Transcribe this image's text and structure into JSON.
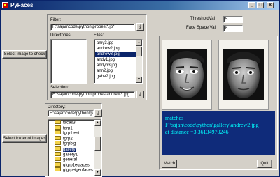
{
  "window": {
    "title": "PyFaces"
  },
  "left_buttons": {
    "select_image": "Select image to check",
    "select_folder": "Select folder of images"
  },
  "probe_panel": {
    "filter_label": "Filter:",
    "filter_value": "F:\\sajan\\code\\python\\probes\\*.jp*",
    "directories_label": "Directories:",
    "files_label": "Files:",
    "files": [
      "amy3.jpg",
      "andrew2.jpg",
      "andrew3.jpg",
      "andy1.jpg",
      "andyb3.jpg",
      "ann2.jpg",
      "gabe2.jpg"
    ],
    "selected_file_index": 2,
    "selection_label": "Selection:",
    "selection_value": "F:\\sajan\\code\\python\\probes\\andrew3.jpg"
  },
  "dir_panel": {
    "directory_label": "Directory:",
    "directory_value": "F:\\sajan\\code\\python\\gallery\\",
    "folders": [
      "faces3",
      "fgrp1",
      "fgrp1test",
      "fgrp2",
      "fgrpbig",
      "gallery",
      "gallery1",
      "general",
      "gfgrp1eglaces",
      "gfgrpeigenfaces"
    ],
    "selected_folder_index": 5
  },
  "params": {
    "threshold_label": "ThresholdVal",
    "threshold_value": "5",
    "facespace_label": "Face Space Val",
    "facespace_value": "6"
  },
  "result": {
    "line1": "matches",
    "line2": "F:\\sajan\\code\\python\\gallery\\andrew2.jpg",
    "line3": "at distance =3.36134970246"
  },
  "buttons": {
    "match": "Match",
    "quit": "Quit"
  },
  "colors": {
    "result_bg": "#0f2b7a",
    "result_text": "#00ffff",
    "selection": "#0a246a"
  },
  "icons": {
    "browse": "down-arrow-to-bar"
  }
}
